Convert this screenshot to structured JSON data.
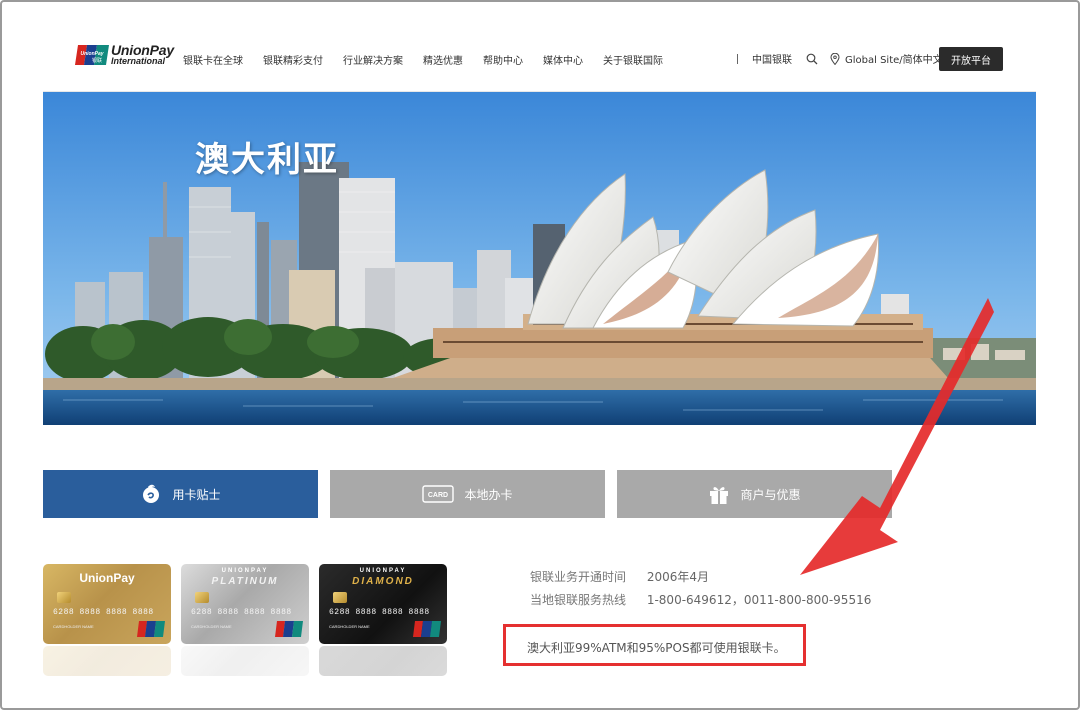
{
  "header": {
    "logo": {
      "text": "UnionPay",
      "sub": "International",
      "mark_text": "UnionPay 银联"
    },
    "nav": [
      {
        "label": "银联卡在全球"
      },
      {
        "label": "银联精彩支付"
      },
      {
        "label": "行业解决方案"
      },
      {
        "label": "精选优惠"
      },
      {
        "label": "帮助中心"
      },
      {
        "label": "媒体中心"
      },
      {
        "label": "关于银联国际"
      }
    ],
    "china_link": "中国银联",
    "global_site": "Global Site/简体中文",
    "open_platform": "开放平台"
  },
  "hero": {
    "title": "澳大利亚"
  },
  "tabs": [
    {
      "label": "用卡贴士",
      "icon": "tips-icon",
      "active": true
    },
    {
      "label": "本地办卡",
      "icon": "card-icon",
      "active": false
    },
    {
      "label": "商户与优惠",
      "icon": "gift-icon",
      "active": false
    }
  ],
  "cards": [
    {
      "brand": "UnionPay",
      "sub": "",
      "number": "6288 8888 8888 8888",
      "holder": "CARDHOLDER NAME"
    },
    {
      "brand": "UNIONPAY",
      "sub": "PLATINUM",
      "number": "6288 8888 8888 8888",
      "holder": "CARDHOLDER NAME"
    },
    {
      "brand": "UNIONPAY",
      "sub": "DIAMOND",
      "number": "6288 8888 8888 8888",
      "holder": "CARDHOLDER NAME"
    }
  ],
  "info": {
    "rows": [
      {
        "label": "银联业务开通时间",
        "value": "2006年4月"
      },
      {
        "label": "当地银联服务热线",
        "value": "1-800-649612，0011-800-800-95516"
      }
    ],
    "highlight": "澳大利亚99%ATM和95%POS都可使用银联卡。"
  },
  "colors": {
    "active_tab": "#2a5e9c",
    "inactive_tab": "#a9a9a9",
    "annotation_red": "#e53030",
    "open_button": "#2b2b2b"
  }
}
